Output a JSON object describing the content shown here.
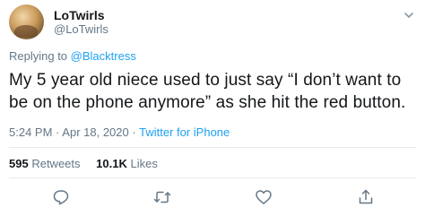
{
  "author": {
    "name": "LoTwirls",
    "handle": "@LoTwirls"
  },
  "reply": {
    "prefix": "Replying to",
    "to": "@Blacktress"
  },
  "tweet": {
    "text": "My 5 year old niece used to just say “I don’t want to be on the phone anymore” as she hit the red button."
  },
  "meta": {
    "time": "5:24 PM",
    "sep1": "·",
    "date": "Apr 18, 2020",
    "sep2": "·",
    "source": "Twitter for iPhone"
  },
  "stats": {
    "retweets_count": "595",
    "retweets_label": "Retweets",
    "likes_count": "10.1K",
    "likes_label": "Likes"
  },
  "icons": {
    "caret": "chevron-down-icon",
    "reply": "reply-icon",
    "retweet": "retweet-icon",
    "like": "heart-icon",
    "share": "share-icon"
  },
  "colors": {
    "link": "#1da1f2",
    "muted": "#657786",
    "text": "#14171a",
    "divider": "#e6ecf0"
  }
}
